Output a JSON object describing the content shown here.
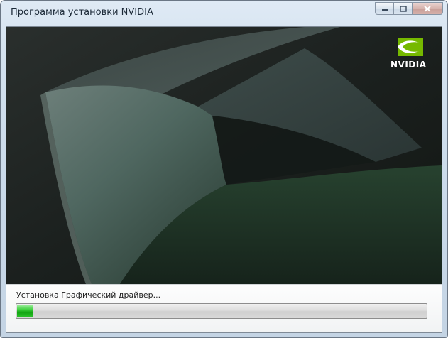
{
  "window": {
    "title": "Программа установки NVIDIA"
  },
  "caption_buttons": {
    "minimize_icon": "minimize-icon",
    "maximize_icon": "maximize-icon",
    "close_icon": "close-icon"
  },
  "branding": {
    "logo_text": "NVIDIA",
    "logo_icon": "nvidia-eye-logo",
    "accent_color": "#76b900"
  },
  "status": {
    "text": "Установка Графический драйвер...",
    "progress_fraction": 0.04,
    "progress_color": "#1fb51f"
  }
}
